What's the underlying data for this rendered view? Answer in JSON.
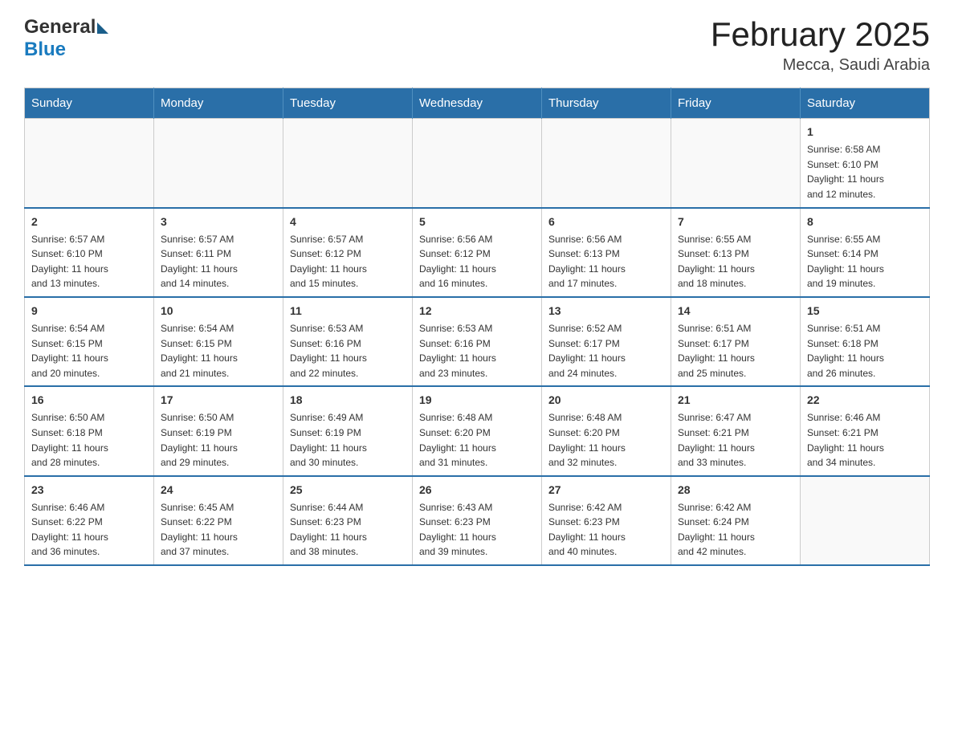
{
  "header": {
    "logo_general": "General",
    "logo_blue": "Blue",
    "title": "February 2025",
    "subtitle": "Mecca, Saudi Arabia"
  },
  "days_of_week": [
    "Sunday",
    "Monday",
    "Tuesday",
    "Wednesday",
    "Thursday",
    "Friday",
    "Saturday"
  ],
  "weeks": [
    {
      "days": [
        {
          "number": "",
          "info": ""
        },
        {
          "number": "",
          "info": ""
        },
        {
          "number": "",
          "info": ""
        },
        {
          "number": "",
          "info": ""
        },
        {
          "number": "",
          "info": ""
        },
        {
          "number": "",
          "info": ""
        },
        {
          "number": "1",
          "info": "Sunrise: 6:58 AM\nSunset: 6:10 PM\nDaylight: 11 hours\nand 12 minutes."
        }
      ]
    },
    {
      "days": [
        {
          "number": "2",
          "info": "Sunrise: 6:57 AM\nSunset: 6:10 PM\nDaylight: 11 hours\nand 13 minutes."
        },
        {
          "number": "3",
          "info": "Sunrise: 6:57 AM\nSunset: 6:11 PM\nDaylight: 11 hours\nand 14 minutes."
        },
        {
          "number": "4",
          "info": "Sunrise: 6:57 AM\nSunset: 6:12 PM\nDaylight: 11 hours\nand 15 minutes."
        },
        {
          "number": "5",
          "info": "Sunrise: 6:56 AM\nSunset: 6:12 PM\nDaylight: 11 hours\nand 16 minutes."
        },
        {
          "number": "6",
          "info": "Sunrise: 6:56 AM\nSunset: 6:13 PM\nDaylight: 11 hours\nand 17 minutes."
        },
        {
          "number": "7",
          "info": "Sunrise: 6:55 AM\nSunset: 6:13 PM\nDaylight: 11 hours\nand 18 minutes."
        },
        {
          "number": "8",
          "info": "Sunrise: 6:55 AM\nSunset: 6:14 PM\nDaylight: 11 hours\nand 19 minutes."
        }
      ]
    },
    {
      "days": [
        {
          "number": "9",
          "info": "Sunrise: 6:54 AM\nSunset: 6:15 PM\nDaylight: 11 hours\nand 20 minutes."
        },
        {
          "number": "10",
          "info": "Sunrise: 6:54 AM\nSunset: 6:15 PM\nDaylight: 11 hours\nand 21 minutes."
        },
        {
          "number": "11",
          "info": "Sunrise: 6:53 AM\nSunset: 6:16 PM\nDaylight: 11 hours\nand 22 minutes."
        },
        {
          "number": "12",
          "info": "Sunrise: 6:53 AM\nSunset: 6:16 PM\nDaylight: 11 hours\nand 23 minutes."
        },
        {
          "number": "13",
          "info": "Sunrise: 6:52 AM\nSunset: 6:17 PM\nDaylight: 11 hours\nand 24 minutes."
        },
        {
          "number": "14",
          "info": "Sunrise: 6:51 AM\nSunset: 6:17 PM\nDaylight: 11 hours\nand 25 minutes."
        },
        {
          "number": "15",
          "info": "Sunrise: 6:51 AM\nSunset: 6:18 PM\nDaylight: 11 hours\nand 26 minutes."
        }
      ]
    },
    {
      "days": [
        {
          "number": "16",
          "info": "Sunrise: 6:50 AM\nSunset: 6:18 PM\nDaylight: 11 hours\nand 28 minutes."
        },
        {
          "number": "17",
          "info": "Sunrise: 6:50 AM\nSunset: 6:19 PM\nDaylight: 11 hours\nand 29 minutes."
        },
        {
          "number": "18",
          "info": "Sunrise: 6:49 AM\nSunset: 6:19 PM\nDaylight: 11 hours\nand 30 minutes."
        },
        {
          "number": "19",
          "info": "Sunrise: 6:48 AM\nSunset: 6:20 PM\nDaylight: 11 hours\nand 31 minutes."
        },
        {
          "number": "20",
          "info": "Sunrise: 6:48 AM\nSunset: 6:20 PM\nDaylight: 11 hours\nand 32 minutes."
        },
        {
          "number": "21",
          "info": "Sunrise: 6:47 AM\nSunset: 6:21 PM\nDaylight: 11 hours\nand 33 minutes."
        },
        {
          "number": "22",
          "info": "Sunrise: 6:46 AM\nSunset: 6:21 PM\nDaylight: 11 hours\nand 34 minutes."
        }
      ]
    },
    {
      "days": [
        {
          "number": "23",
          "info": "Sunrise: 6:46 AM\nSunset: 6:22 PM\nDaylight: 11 hours\nand 36 minutes."
        },
        {
          "number": "24",
          "info": "Sunrise: 6:45 AM\nSunset: 6:22 PM\nDaylight: 11 hours\nand 37 minutes."
        },
        {
          "number": "25",
          "info": "Sunrise: 6:44 AM\nSunset: 6:23 PM\nDaylight: 11 hours\nand 38 minutes."
        },
        {
          "number": "26",
          "info": "Sunrise: 6:43 AM\nSunset: 6:23 PM\nDaylight: 11 hours\nand 39 minutes."
        },
        {
          "number": "27",
          "info": "Sunrise: 6:42 AM\nSunset: 6:23 PM\nDaylight: 11 hours\nand 40 minutes."
        },
        {
          "number": "28",
          "info": "Sunrise: 6:42 AM\nSunset: 6:24 PM\nDaylight: 11 hours\nand 42 minutes."
        },
        {
          "number": "",
          "info": ""
        }
      ]
    }
  ]
}
